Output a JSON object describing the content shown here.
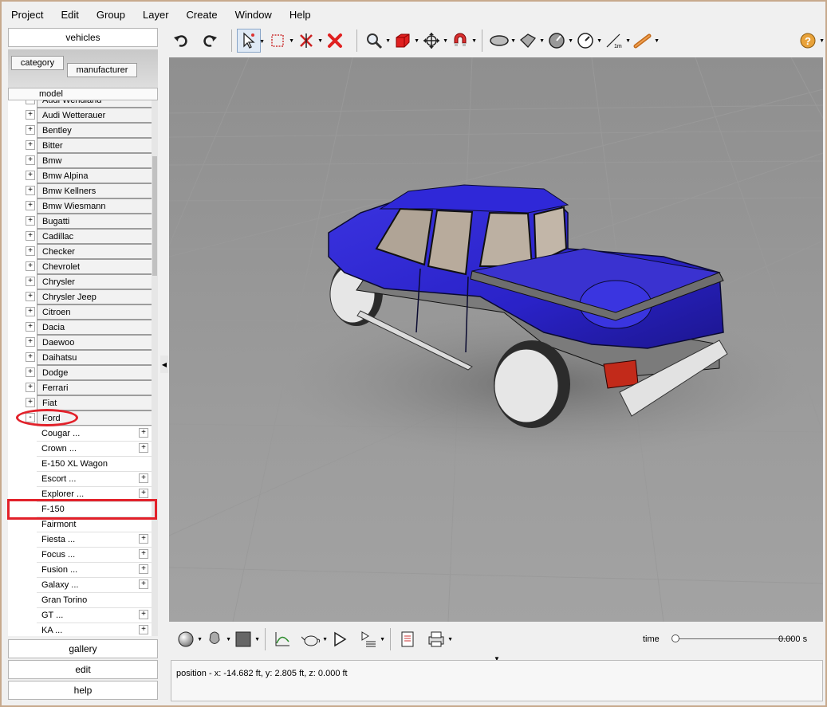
{
  "menu": [
    "Project",
    "Edit",
    "Group",
    "Layer",
    "Create",
    "Window",
    "Help"
  ],
  "left_panel": {
    "vehicles_button": "vehicles",
    "tabs": {
      "category": "category",
      "manufacturer": "manufacturer"
    },
    "column_header": "model",
    "list": [
      {
        "label": "Audi Wendland",
        "type": "parent",
        "expander": "+"
      },
      {
        "label": "Audi Wetterauer",
        "type": "parent",
        "expander": "+"
      },
      {
        "label": "Bentley",
        "type": "parent",
        "expander": "+"
      },
      {
        "label": "Bitter",
        "type": "parent",
        "expander": "+"
      },
      {
        "label": "Bmw",
        "type": "parent",
        "expander": "+"
      },
      {
        "label": "Bmw Alpina",
        "type": "parent",
        "expander": "+"
      },
      {
        "label": "Bmw Kellners",
        "type": "parent",
        "expander": "+"
      },
      {
        "label": "Bmw Wiesmann",
        "type": "parent",
        "expander": "+"
      },
      {
        "label": "Bugatti",
        "type": "parent",
        "expander": "+"
      },
      {
        "label": "Cadillac",
        "type": "parent",
        "expander": "+"
      },
      {
        "label": "Checker",
        "type": "parent",
        "expander": "+"
      },
      {
        "label": "Chevrolet",
        "type": "parent",
        "expander": "+"
      },
      {
        "label": "Chrysler",
        "type": "parent",
        "expander": "+"
      },
      {
        "label": "Chrysler Jeep",
        "type": "parent",
        "expander": "+"
      },
      {
        "label": "Citroen",
        "type": "parent",
        "expander": "+"
      },
      {
        "label": "Dacia",
        "type": "parent",
        "expander": "+"
      },
      {
        "label": "Daewoo",
        "type": "parent",
        "expander": "+"
      },
      {
        "label": "Daihatsu",
        "type": "parent",
        "expander": "+"
      },
      {
        "label": "Dodge",
        "type": "parent",
        "expander": "+"
      },
      {
        "label": "Ferrari",
        "type": "parent",
        "expander": "+"
      },
      {
        "label": "Fiat",
        "type": "parent",
        "expander": "+"
      },
      {
        "label": "Ford",
        "type": "parent",
        "expander": "-"
      },
      {
        "label": "Cougar ...",
        "type": "child",
        "plus": "+"
      },
      {
        "label": "Crown ...",
        "type": "child",
        "plus": "+"
      },
      {
        "label": "E-150 XL Wagon",
        "type": "child",
        "plus": ""
      },
      {
        "label": "Escort ...",
        "type": "child",
        "plus": "+"
      },
      {
        "label": "Explorer ...",
        "type": "child",
        "plus": "+"
      },
      {
        "label": "F-150",
        "type": "child",
        "plus": ""
      },
      {
        "label": "Fairmont",
        "type": "child",
        "plus": ""
      },
      {
        "label": "Fiesta ...",
        "type": "child",
        "plus": "+"
      },
      {
        "label": "Focus ...",
        "type": "child",
        "plus": "+"
      },
      {
        "label": "Fusion ...",
        "type": "child",
        "plus": "+"
      },
      {
        "label": "Galaxy ...",
        "type": "child",
        "plus": "+"
      },
      {
        "label": "Gran Torino",
        "type": "child",
        "plus": ""
      },
      {
        "label": "GT ...",
        "type": "child",
        "plus": "+"
      },
      {
        "label": "KA ...",
        "type": "child",
        "plus": "+"
      }
    ],
    "gallery_button": "gallery",
    "edit_button": "edit",
    "help_button": "help"
  },
  "toolbar": {
    "tools": [
      "undo-icon",
      "redo-icon",
      "select-arrow-icon",
      "select-rect-icon",
      "mirror-icon",
      "delete-icon",
      "zoom-icon",
      "cube-icon",
      "move-icon",
      "magnet-icon",
      "ellipse-icon",
      "plane-icon",
      "angle-icon",
      "gauge-icon",
      "ruler-1m-icon",
      "baton-icon",
      "help-icon"
    ],
    "ruler_label": "1m"
  },
  "bottom_toolbar": {
    "time_label": "time",
    "time_value": "0.000 s",
    "time_fraction": 0
  },
  "status": {
    "position_text": "position - x: -14.682 ft, y: 2.805 ft, z: 0.000 ft"
  },
  "colors": {
    "accent_red": "#e2212a",
    "truck_blue": "#2a22c8"
  }
}
